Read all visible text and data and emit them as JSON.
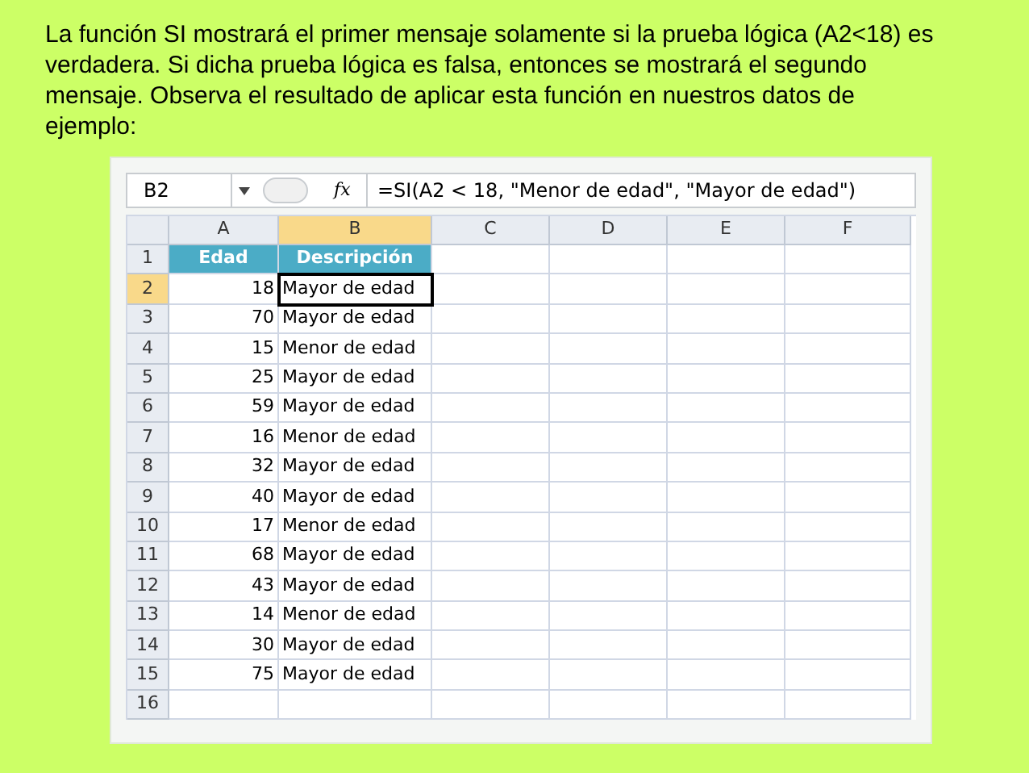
{
  "intro": "La función SI mostrará el primer mensaje solamente si la prueba lógica (A2<18) es verdadera. Si dicha prueba lógica es falsa, entonces se mostrará el segundo mensaje. Observa el resultado de aplicar esta función en nuestros datos de ejemplo:",
  "formula_bar": {
    "name_box": "B2",
    "function_label": "fx",
    "formula": "=SI(A2 < 18, \"Menor de edad\", \"Mayor de edad\")"
  },
  "columns": [
    {
      "label": "A",
      "selected": false
    },
    {
      "label": "B",
      "selected": true
    },
    {
      "label": "C",
      "selected": false
    },
    {
      "label": "D",
      "selected": false
    },
    {
      "label": "E",
      "selected": false
    },
    {
      "label": "F",
      "selected": false
    }
  ],
  "rows": [
    {
      "number": "1",
      "selected": false,
      "kind": "header",
      "cells": [
        {
          "text": "Edad",
          "selected": false
        },
        {
          "text": "Descripción",
          "selected": false
        }
      ]
    },
    {
      "number": "2",
      "selected": true,
      "kind": "data",
      "cells": [
        {
          "text": "18",
          "selected": false
        },
        {
          "text": "Mayor de edad",
          "selected": true
        }
      ]
    },
    {
      "number": "3",
      "selected": false,
      "kind": "data",
      "cells": [
        {
          "text": "70",
          "selected": false
        },
        {
          "text": "Mayor de edad",
          "selected": false
        }
      ]
    },
    {
      "number": "4",
      "selected": false,
      "kind": "data",
      "cells": [
        {
          "text": "15",
          "selected": false
        },
        {
          "text": "Menor de edad",
          "selected": false
        }
      ]
    },
    {
      "number": "5",
      "selected": false,
      "kind": "data",
      "cells": [
        {
          "text": "25",
          "selected": false
        },
        {
          "text": "Mayor de edad",
          "selected": false
        }
      ]
    },
    {
      "number": "6",
      "selected": false,
      "kind": "data",
      "cells": [
        {
          "text": "59",
          "selected": false
        },
        {
          "text": "Mayor de edad",
          "selected": false
        }
      ]
    },
    {
      "number": "7",
      "selected": false,
      "kind": "data",
      "cells": [
        {
          "text": "16",
          "selected": false
        },
        {
          "text": "Menor de edad",
          "selected": false
        }
      ]
    },
    {
      "number": "8",
      "selected": false,
      "kind": "data",
      "cells": [
        {
          "text": "32",
          "selected": false
        },
        {
          "text": "Mayor de edad",
          "selected": false
        }
      ]
    },
    {
      "number": "9",
      "selected": false,
      "kind": "data",
      "cells": [
        {
          "text": "40",
          "selected": false
        },
        {
          "text": "Mayor de edad",
          "selected": false
        }
      ]
    },
    {
      "number": "10",
      "selected": false,
      "kind": "data",
      "cells": [
        {
          "text": "17",
          "selected": false
        },
        {
          "text": "Menor de edad",
          "selected": false
        }
      ]
    },
    {
      "number": "11",
      "selected": false,
      "kind": "data",
      "cells": [
        {
          "text": "68",
          "selected": false
        },
        {
          "text": "Mayor de edad",
          "selected": false
        }
      ]
    },
    {
      "number": "12",
      "selected": false,
      "kind": "data",
      "cells": [
        {
          "text": "43",
          "selected": false
        },
        {
          "text": "Mayor de edad",
          "selected": false
        }
      ]
    },
    {
      "number": "13",
      "selected": false,
      "kind": "data",
      "cells": [
        {
          "text": "14",
          "selected": false
        },
        {
          "text": "Menor de edad",
          "selected": false
        }
      ]
    },
    {
      "number": "14",
      "selected": false,
      "kind": "data",
      "cells": [
        {
          "text": "30",
          "selected": false
        },
        {
          "text": "Mayor de edad",
          "selected": false
        }
      ]
    },
    {
      "number": "15",
      "selected": false,
      "kind": "data",
      "cells": [
        {
          "text": "75",
          "selected": false
        },
        {
          "text": "Mayor de edad",
          "selected": false
        }
      ]
    },
    {
      "number": "16",
      "selected": false,
      "kind": "data"
    }
  ]
}
